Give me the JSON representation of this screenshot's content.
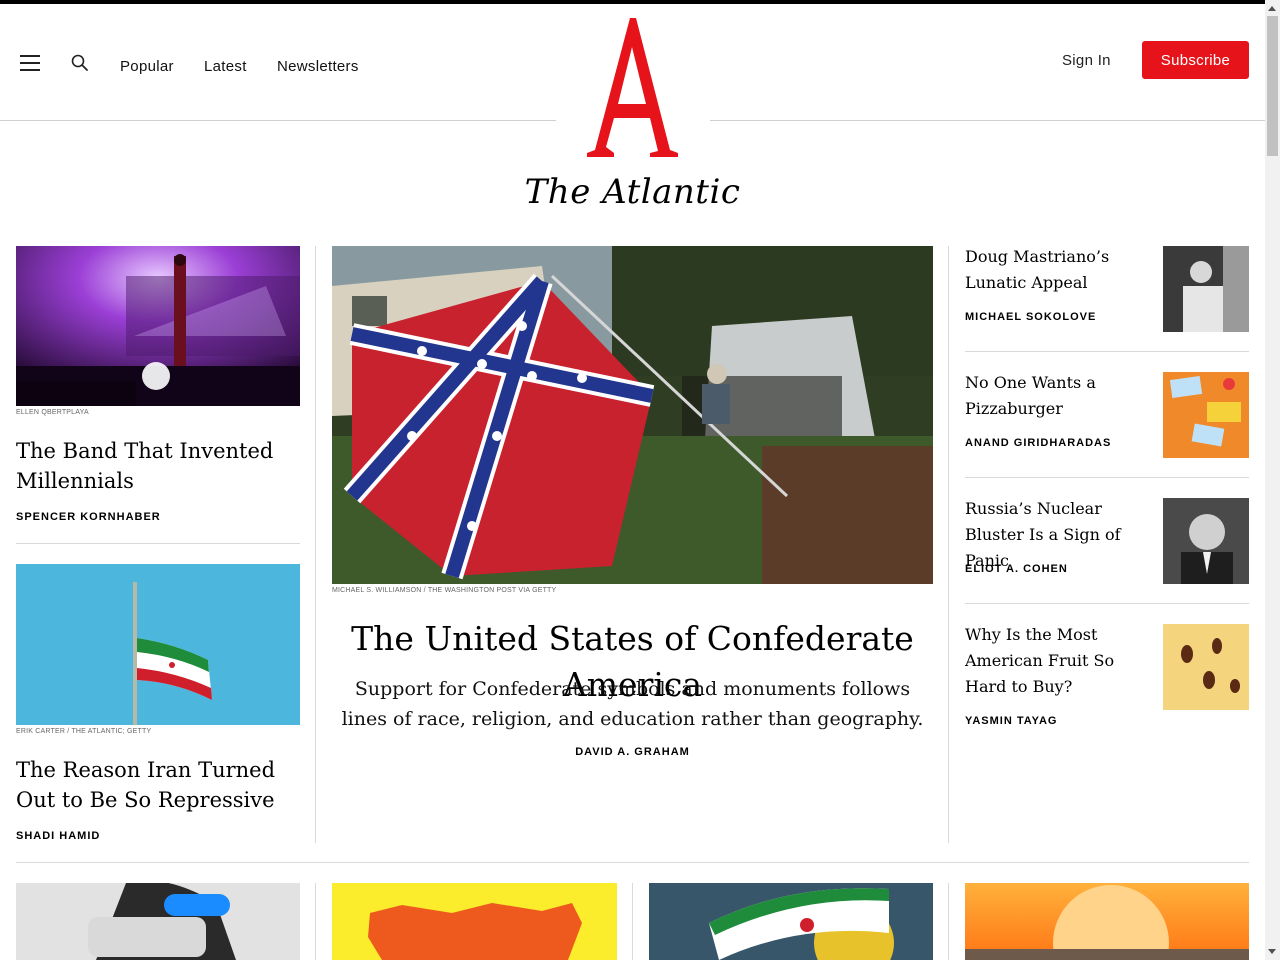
{
  "nav": {
    "links": [
      "Popular",
      "Latest",
      "Newsletters"
    ],
    "sign_in": "Sign In",
    "subscribe": "Subscribe",
    "logo_letter": "A",
    "logo_text": "The Atlantic",
    "brand_color": "#e7131a"
  },
  "left": [
    {
      "credit": "ELLEN QBERTPLAYA",
      "headline": "The Band That Invented Millennials",
      "byline": "SPENCER KORNHABER"
    },
    {
      "credit": "ERIK CARTER / THE ATLANTIC; GETTY",
      "headline": "The Reason Iran Turned Out to Be So Repressive",
      "byline": "SHADI HAMID"
    }
  ],
  "lead": {
    "credit": "MICHAEL S. WILLIAMSON / THE WASHINGTON POST VIA GETTY",
    "headline": "The United States of Confederate America",
    "dek": "Support for Confederate symbols and monuments follows lines of race, religion, and education rather than geography.",
    "byline": "DAVID A. GRAHAM"
  },
  "right": [
    {
      "headline": "Doug Mastriano’s Lunatic Appeal",
      "byline": "MICHAEL SOKOLOVE"
    },
    {
      "headline": "No One Wants a Pizzaburger",
      "byline": "ANAND GIRIDHARADAS"
    },
    {
      "headline": "Russia’s Nuclear Bluster Is a Sign of Panic",
      "byline": "ELIOT A. COHEN"
    },
    {
      "headline": "Why Is the Most American Fruit So Hard to Buy?",
      "byline": "YASMIN TAYAG"
    }
  ],
  "icons": [
    "menu-icon",
    "search-icon"
  ]
}
